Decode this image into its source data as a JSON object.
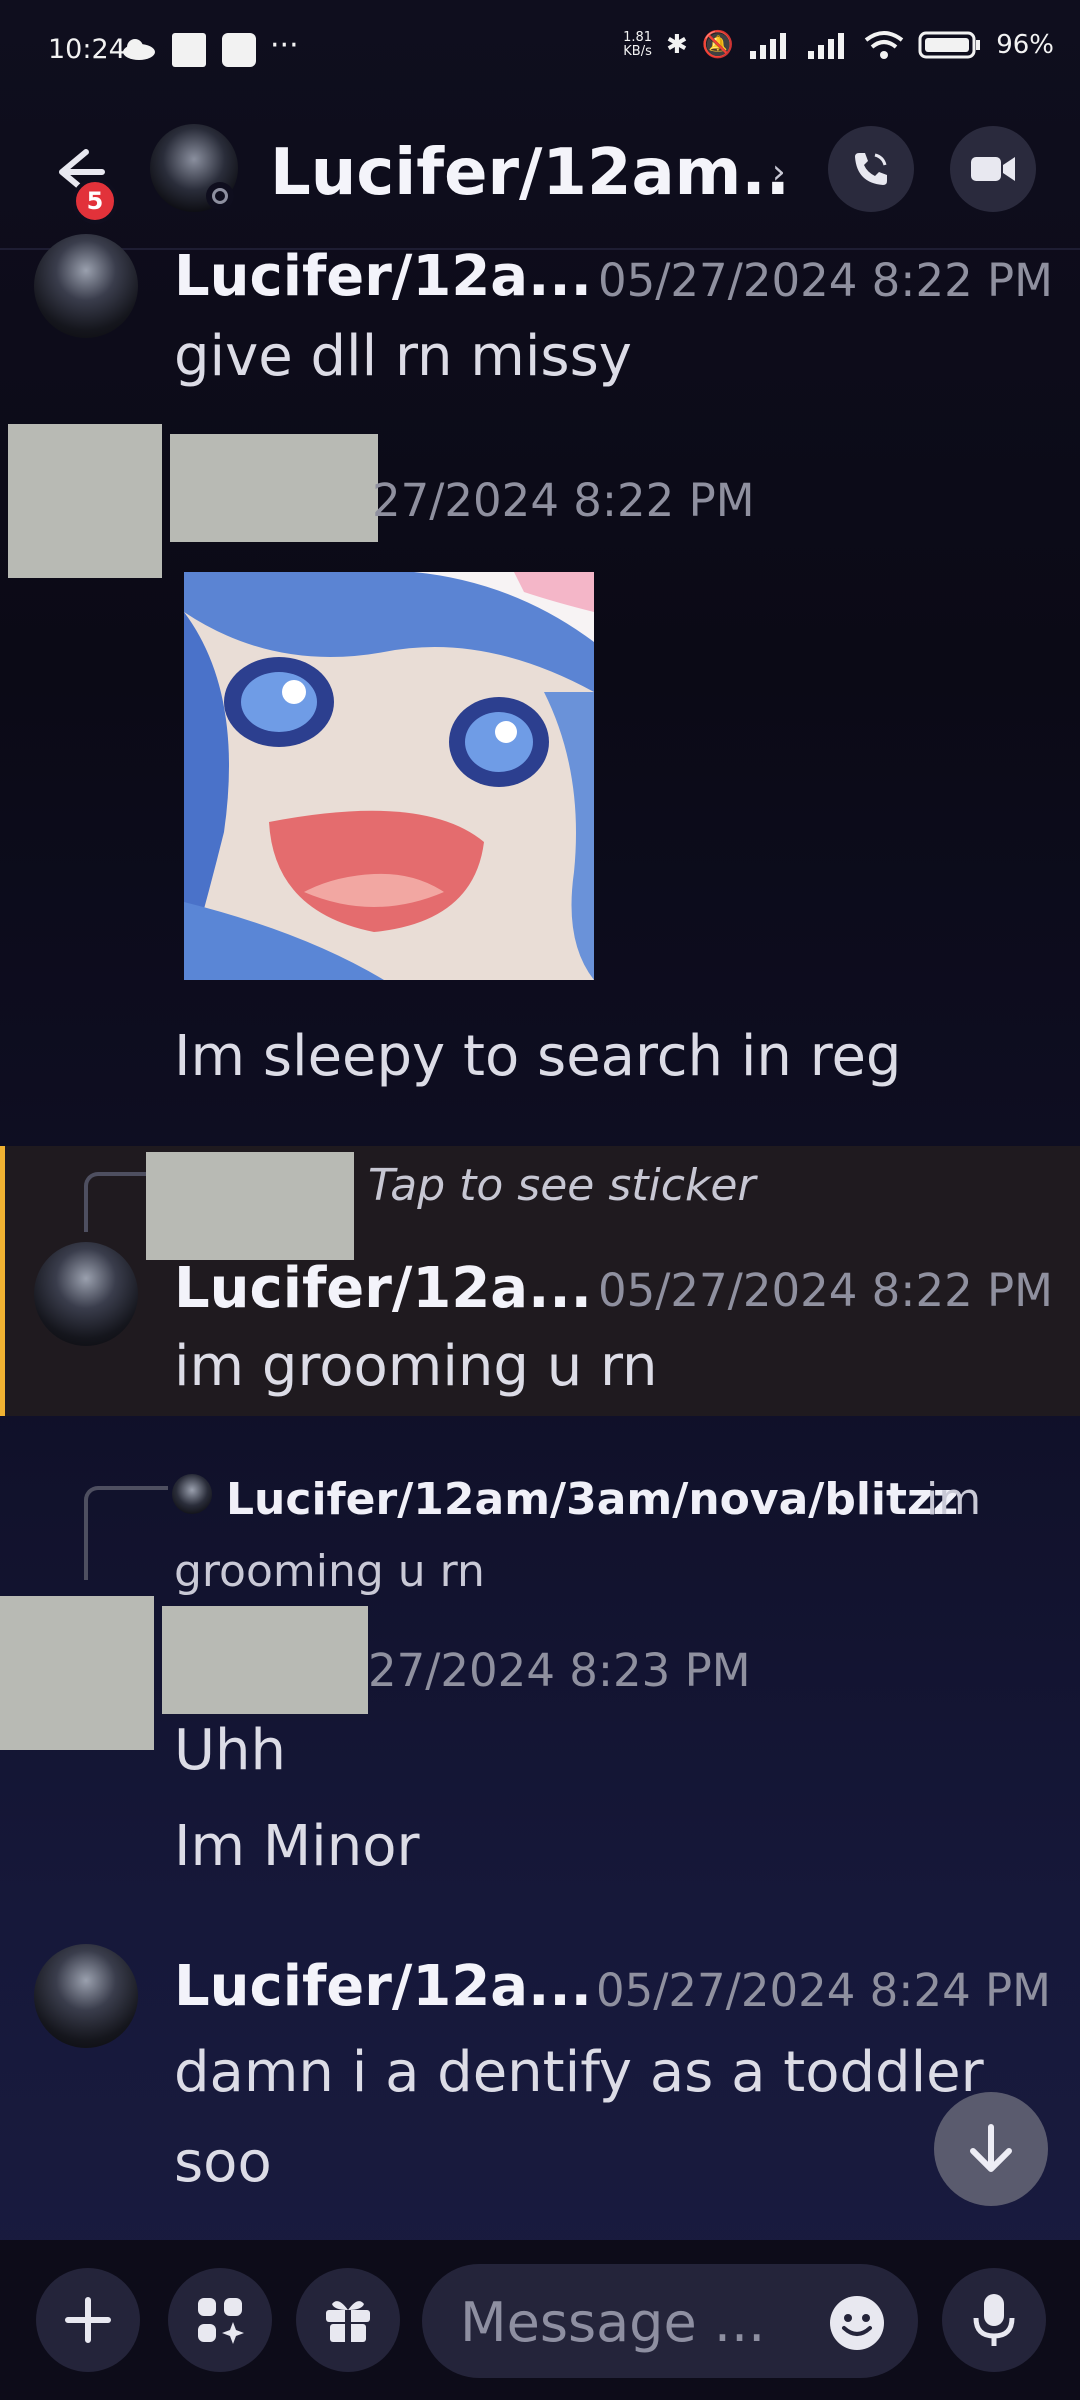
{
  "status_bar": {
    "time": "10:24",
    "net_speed_value": "1.81",
    "net_speed_unit": "KB/s",
    "battery": "96%"
  },
  "header": {
    "title": "Lucifer/12am..",
    "notification_count": "5",
    "chevron": "›"
  },
  "messages": [
    {
      "author": "Lucifer/12a...",
      "timestamp": "05/27/2024 8:22 PM",
      "text": "give dll rn missy"
    },
    {
      "timestamp_partial": "27/2024 8:22 PM",
      "text": "Im sleepy to search in reg"
    },
    {
      "reply_preview": "Tap to see sticker",
      "author": "Lucifer/12a...",
      "timestamp": "05/27/2024 8:22 PM",
      "text": "im grooming u rn"
    },
    {
      "reply_author": "Lucifer/12am/3am/nova/blitzz",
      "reply_text_1": "im",
      "reply_text_2": "grooming u rn",
      "timestamp_partial": "27/2024 8:23 PM",
      "text_line1": "Uhh",
      "text_line2": "Im Minor"
    },
    {
      "author": "Lucifer/12a...",
      "timestamp": "05/27/2024 8:24 PM",
      "text_line1": "damn i a dentify  as a toddler",
      "text_line2": "soo"
    }
  ],
  "composer": {
    "placeholder": "Message ..."
  },
  "icons": [
    "back-arrow-icon",
    "voice-call-icon",
    "video-call-icon",
    "plus-icon",
    "apps-icon",
    "gift-icon",
    "emoji-icon",
    "microphone-icon",
    "arrow-down-icon"
  ]
}
